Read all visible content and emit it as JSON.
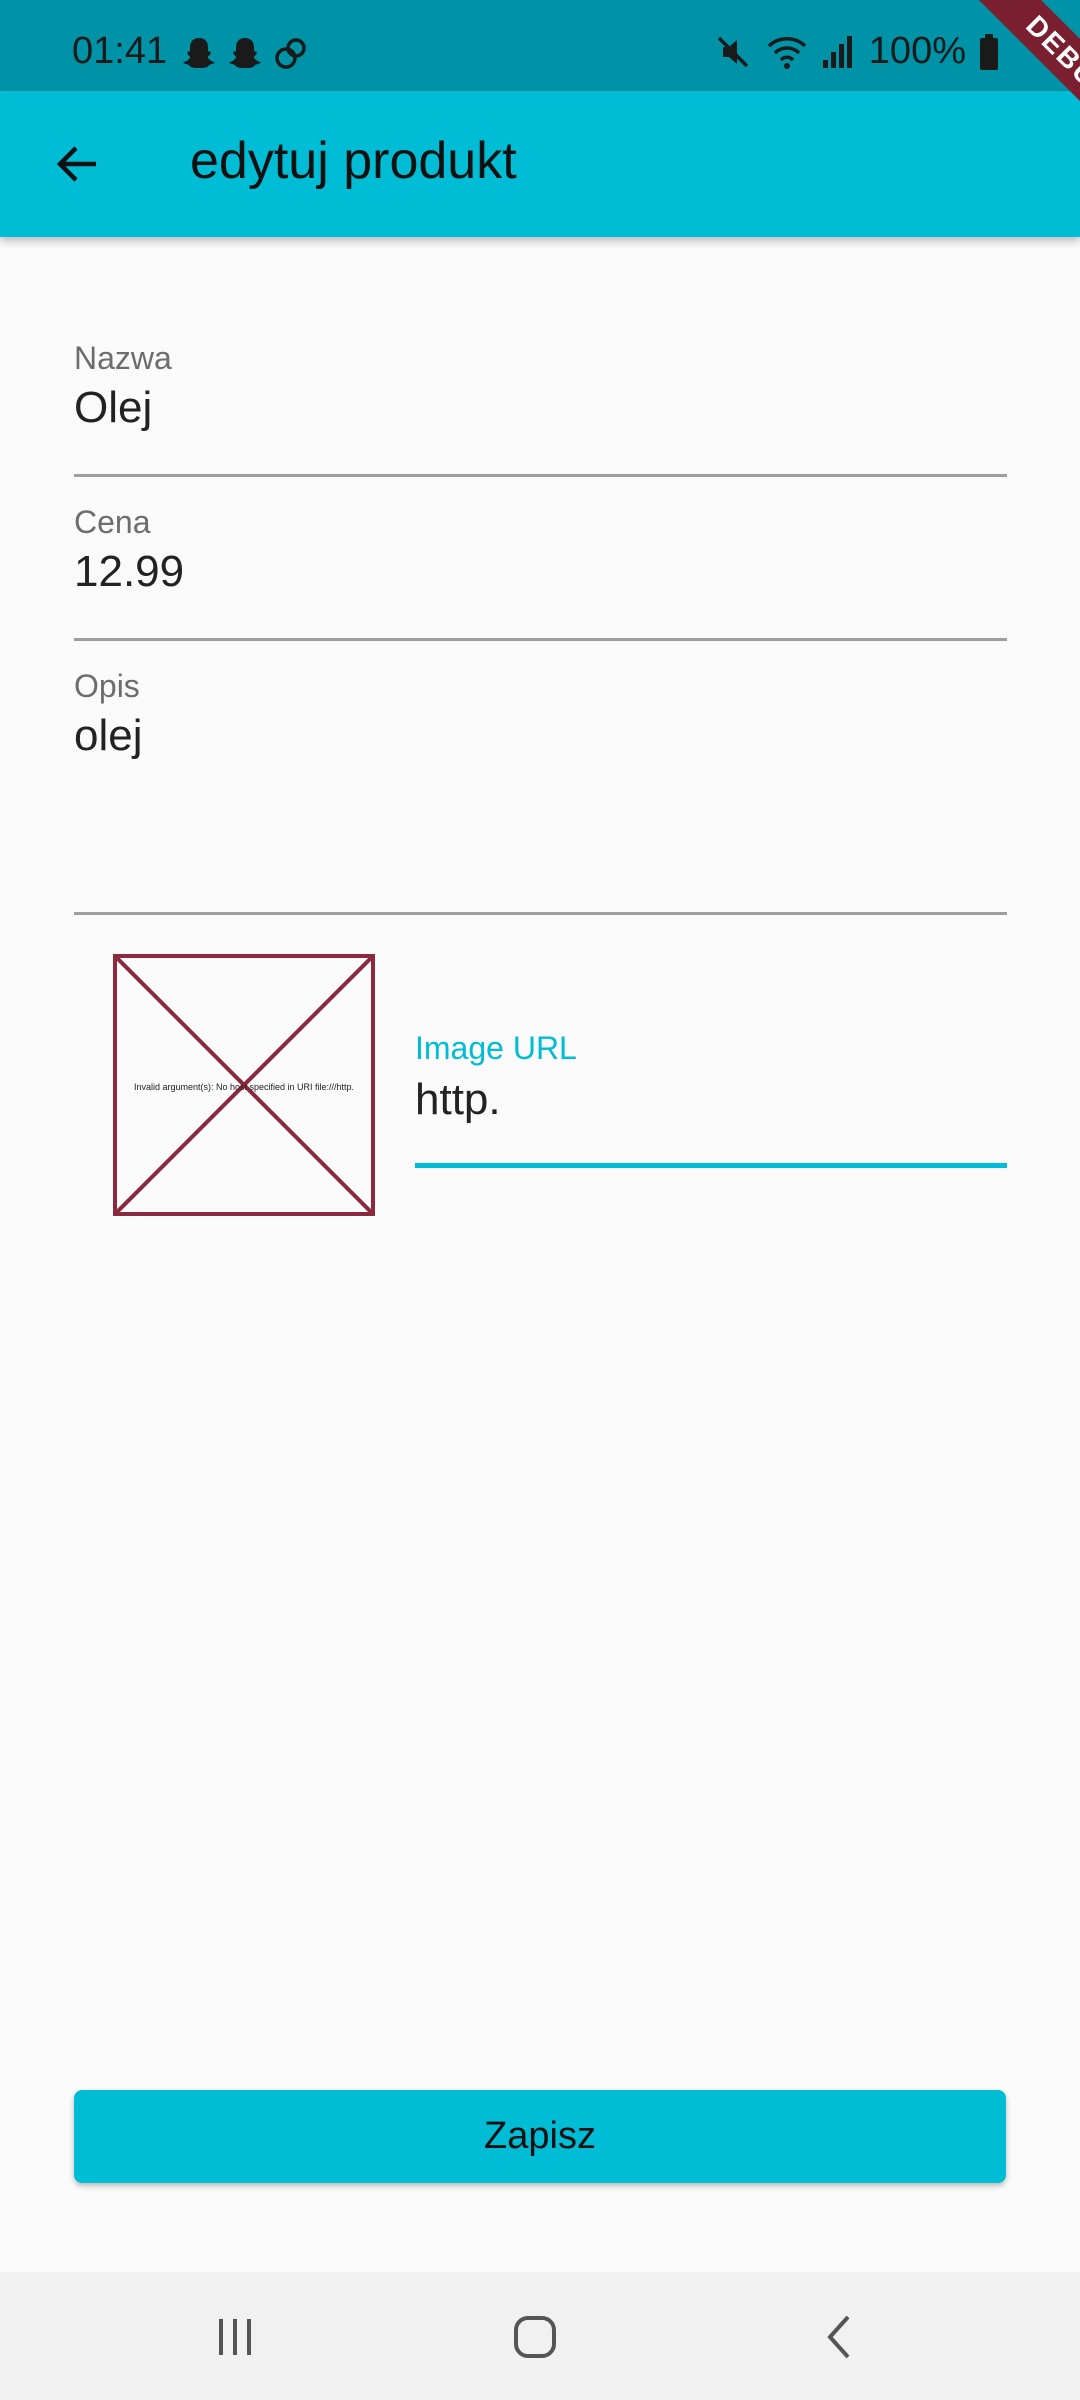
{
  "status_bar": {
    "time": "01:41",
    "battery": "100%",
    "icons": [
      "snapchat-icon",
      "snapchat-icon",
      "link-icon",
      "mute-icon",
      "wifi-icon",
      "signal-icon",
      "battery-icon"
    ]
  },
  "app_bar": {
    "title": "edytuj produkt",
    "back_icon": "arrow-left-icon"
  },
  "debug_banner": "DEBUG",
  "form": {
    "name": {
      "label": "Nazwa",
      "value": "Olej"
    },
    "price": {
      "label": "Cena",
      "value": "12.99"
    },
    "description": {
      "label": "Opis",
      "value": "olej"
    },
    "image_preview_error": "Invalid argument(s): No host specified in URI file:///http.",
    "image_url": {
      "label": "Image URL",
      "value": "http."
    }
  },
  "save_button": {
    "label": "Zapisz"
  },
  "colors": {
    "primary": "#00bcd4",
    "status_bar": "#0093a8",
    "error_border": "#8b2a3e"
  }
}
